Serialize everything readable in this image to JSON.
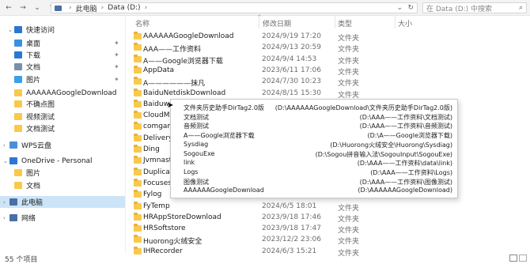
{
  "toolbar": {
    "back_icon": "left-arrow-icon",
    "forward_icon": "right-arrow-icon",
    "down_icon": "chevron-down-icon",
    "up_icon": "up-arrow-icon"
  },
  "address": {
    "crumbs": [
      "此电脑",
      "Data (D:)"
    ],
    "chevron": "›",
    "end_arrow": "⌄",
    "refresh": "↻"
  },
  "search": {
    "placeholder": "在 Data (D:) 中搜索",
    "icon": "⌕"
  },
  "sidebar": {
    "items": [
      {
        "label": "快速访问",
        "icon": "star-icon",
        "color": "#2b78d4",
        "pinned": false,
        "expand": "⌄"
      },
      {
        "label": "桌面",
        "icon": "desktop-icon",
        "color": "#3b8fe0",
        "pinned": true
      },
      {
        "label": "下载",
        "icon": "download-icon",
        "color": "#2b78d4",
        "pinned": true
      },
      {
        "label": "文档",
        "icon": "document-icon",
        "color": "#7a8fa8",
        "pinned": true
      },
      {
        "label": "图片",
        "icon": "picture-icon",
        "color": "#3aa0e8",
        "pinned": true
      },
      {
        "label": "AAAAAAGoogleDownload",
        "icon": "folder-icon",
        "color": "#f8c94b",
        "pinned": false
      },
      {
        "label": "不确点图",
        "icon": "folder-icon",
        "color": "#f8c94b",
        "pinned": false
      },
      {
        "label": "视频测试",
        "icon": "folder-icon",
        "color": "#f8c94b",
        "pinned": false
      },
      {
        "label": "文档测试",
        "icon": "folder-icon",
        "color": "#f8c94b",
        "pinned": false
      },
      {
        "label": "WPS云盘",
        "icon": "cloud-icon",
        "color": "#4a90d9",
        "pinned": false,
        "expand": "›"
      },
      {
        "label": "OneDrive - Personal",
        "icon": "onedrive-icon",
        "color": "#2b78d4",
        "pinned": false,
        "expand": "⌄"
      },
      {
        "label": "图片",
        "icon": "folder-icon",
        "color": "#f8c94b",
        "pinned": false
      },
      {
        "label": "文档",
        "icon": "folder-icon",
        "color": "#f8c94b",
        "pinned": false
      },
      {
        "label": "此电脑",
        "icon": "computer-icon",
        "color": "#4a6fa5",
        "pinned": false,
        "expand": "›",
        "selected": true
      },
      {
        "label": "网络",
        "icon": "network-icon",
        "color": "#4a6fa5",
        "pinned": false,
        "expand": "›"
      }
    ],
    "pin_glyph": "✦"
  },
  "columns": {
    "name": "名称",
    "date": "修改日期",
    "type": "类型",
    "size": "大小",
    "sort_arrow": "^"
  },
  "files": [
    {
      "name": "AAAAAAGoogleDownload",
      "date": "2024/9/19 17:20",
      "type": "文件夹"
    },
    {
      "name": "AAA——工作资料",
      "date": "2024/9/13 20:59",
      "type": "文件夹"
    },
    {
      "name": "A——Google浏览器下载",
      "date": "2024/9/4 14:53",
      "type": "文件夹"
    },
    {
      "name": "AppData",
      "date": "2023/6/11 17:06",
      "type": "文件夹"
    },
    {
      "name": "A——————抹凡",
      "date": "2024/7/30 10:23",
      "type": "文件夹"
    },
    {
      "name": "BaiduNetdiskDownload",
      "date": "2024/8/15 15:30",
      "type": "文件夹"
    },
    {
      "name": "Baiduwp",
      "date": "",
      "type": ""
    },
    {
      "name": "CloudMu",
      "date": "",
      "type": ""
    },
    {
      "name": "comgame",
      "date": "",
      "type": ""
    },
    {
      "name": "DeliveryO",
      "date": "",
      "type": ""
    },
    {
      "name": "Ding",
      "date": "",
      "type": ""
    },
    {
      "name": "Jvmnaste",
      "date": "",
      "type": ""
    },
    {
      "name": "Duplicate",
      "date": "",
      "type": ""
    },
    {
      "name": "Focuses",
      "date": "",
      "type": ""
    },
    {
      "name": "Fylog",
      "date": "",
      "type": ""
    },
    {
      "name": "FyTemp",
      "date": "2024/6/5 18:01",
      "type": "文件夹"
    },
    {
      "name": "HRAppStoreDownload",
      "date": "2023/9/18 17:46",
      "type": "文件夹"
    },
    {
      "name": "HRSoftstore",
      "date": "2023/9/18 17:47",
      "type": "文件夹"
    },
    {
      "name": "Huorong火绒安全",
      "date": "2023/12/2 23:06",
      "type": "文件夹"
    },
    {
      "name": "IHRecorder",
      "date": "2024/6/3 15:21",
      "type": "文件夹"
    }
  ],
  "popup": [
    {
      "name": "文件夹历史助手DirTag2.0版",
      "path": "(D:\\AAAAAAGoogleDownload\\文件夹历史助手DirTag2.0版)"
    },
    {
      "name": "文档测试",
      "path": "(D:\\AAA——工作资料\\文档测试)"
    },
    {
      "name": "音频测试",
      "path": "(D:\\AAA——工作资料\\音频测试)"
    },
    {
      "name": "A——Google浏览器下载",
      "path": "(D:\\A——Google浏览器下载)"
    },
    {
      "name": "Sysdiag",
      "path": "(D:\\Huorong火绒安全\\Huorong\\Sysdiag)"
    },
    {
      "name": "SogouExe",
      "path": "(D:\\Sogou拼音输入法\\SogouInput\\SogouExe)"
    },
    {
      "name": "link",
      "path": "(D:\\AAA——工作资料\\data\\link)"
    },
    {
      "name": "Logs",
      "path": "(D:\\AAA——工作资料\\Logs)"
    },
    {
      "name": "图像测试",
      "path": "(D:\\AAA——工作资料\\图像测试)"
    },
    {
      "name": "AAAAAAGoogleDownload",
      "path": "(D:\\AAAAAAGoogleDownload)"
    }
  ],
  "status": {
    "count": "55 个项目"
  }
}
